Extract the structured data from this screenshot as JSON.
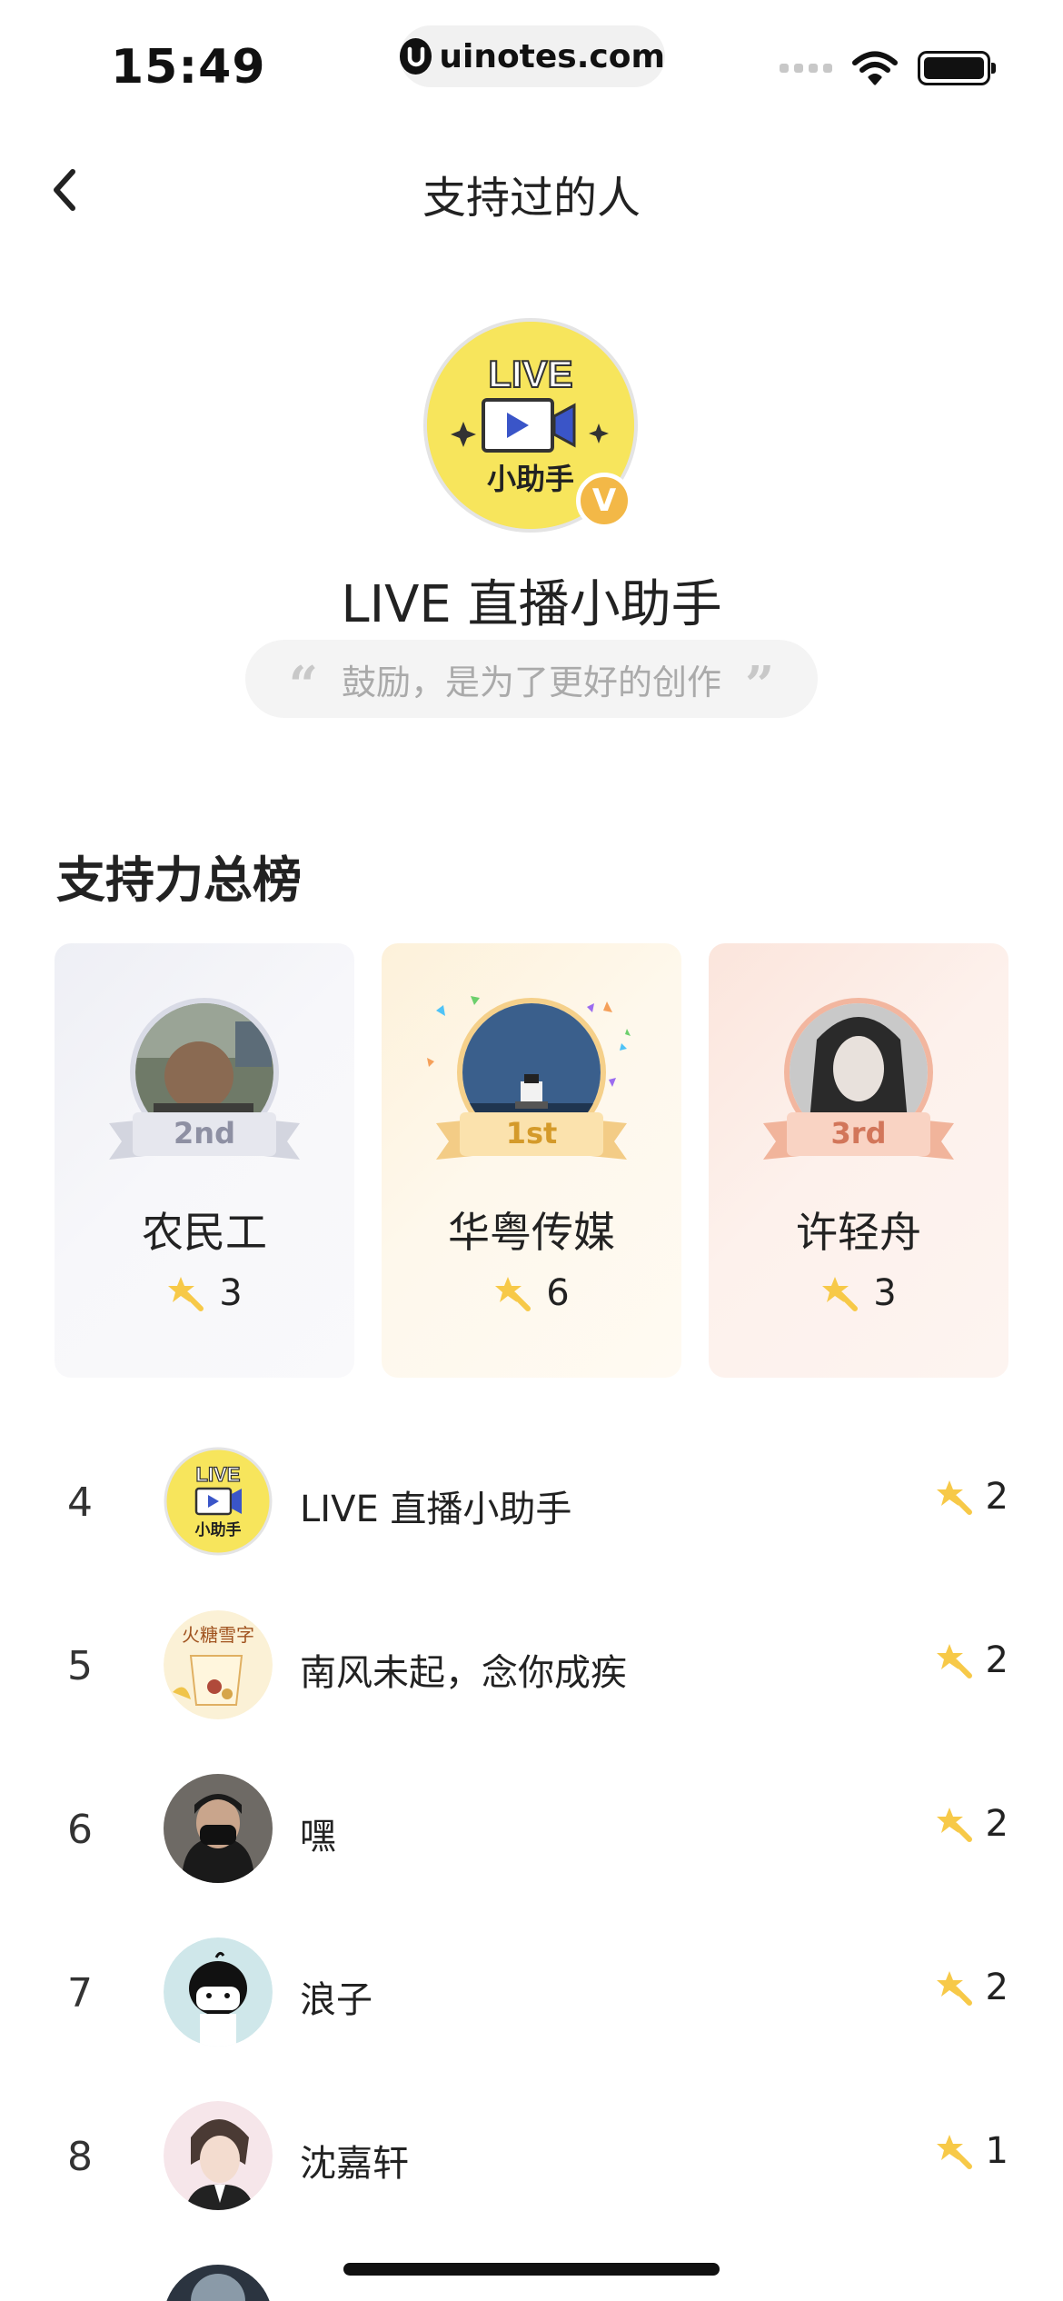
{
  "status_bar": {
    "time": "15:49",
    "url": "uinotes.com"
  },
  "nav": {
    "title": "支持过的人"
  },
  "profile": {
    "name": "LIVE 直播小助手",
    "quote": "鼓励，是为了更好的创作",
    "avatar_text_top": "LIVE",
    "avatar_text_bottom": "小助手",
    "badge": "V"
  },
  "leaderboard": {
    "title": "支持力总榜",
    "podium": [
      {
        "rank_label": "2nd",
        "name": "农民工",
        "score": "3"
      },
      {
        "rank_label": "1st",
        "name": "华粤传媒",
        "score": "6"
      },
      {
        "rank_label": "3rd",
        "name": "许轻舟",
        "score": "3"
      }
    ],
    "list": [
      {
        "rank": "4",
        "name": "LIVE 直播小助手",
        "score": "2"
      },
      {
        "rank": "5",
        "name": "南风未起，念你成疾",
        "score": "2",
        "avatar_text": "火糖雪字"
      },
      {
        "rank": "6",
        "name": "嘿",
        "score": "2"
      },
      {
        "rank": "7",
        "name": "浪子",
        "score": "2"
      },
      {
        "rank": "8",
        "name": "沈嘉轩",
        "score": "1"
      }
    ]
  },
  "colors": {
    "accent_yellow": "#f7c948",
    "gold": "#f3b847",
    "background": "#ffffff"
  }
}
